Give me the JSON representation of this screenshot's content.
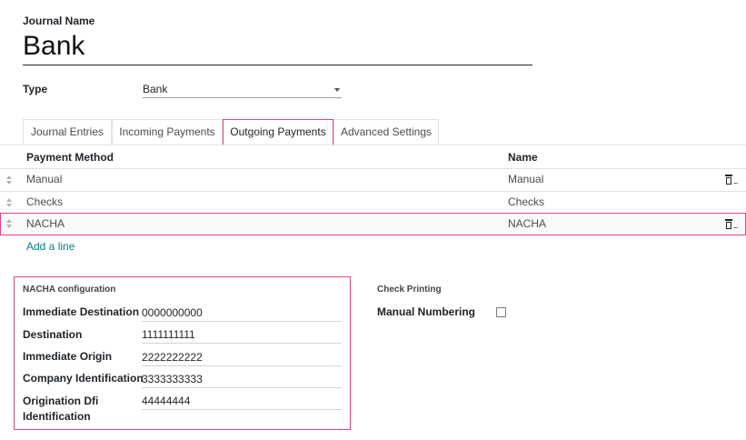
{
  "header": {
    "journal_name_label": "Journal Name",
    "journal_name_value": "Bank",
    "type_label": "Type",
    "type_value": "Bank"
  },
  "tabs": [
    {
      "label": "Journal Entries",
      "active": false
    },
    {
      "label": "Incoming Payments",
      "active": false
    },
    {
      "label": "Outgoing Payments",
      "active": true
    },
    {
      "label": "Advanced Settings",
      "active": false
    }
  ],
  "table": {
    "columns": [
      "Payment Method",
      "Name"
    ],
    "rows": [
      {
        "method": "Manual",
        "name": "Manual"
      },
      {
        "method": "Checks",
        "name": "Checks"
      },
      {
        "method": "NACHA",
        "name": "NACHA"
      }
    ],
    "trash_text": "...",
    "add_line": "Add a line"
  },
  "nacha": {
    "title": "NACHA configuration",
    "fields": [
      {
        "label": "Immediate Destination",
        "value": "0000000000"
      },
      {
        "label": "Destination",
        "value": "1111111111"
      },
      {
        "label": "Immediate Origin",
        "value": "2222222222"
      },
      {
        "label": "Company Identification",
        "value": "3333333333"
      },
      {
        "label": "Origination Dfi",
        "label2": "Identification",
        "value": "44444444"
      }
    ]
  },
  "check_printing": {
    "title": "Check Printing",
    "manual_numbering_label": "Manual Numbering",
    "manual_numbering_checked": false
  },
  "colors": {
    "highlight": "#e0457b",
    "link": "#017e84"
  },
  "icons": [
    "sort-handle-icon",
    "trash-icon",
    "caret-down-icon",
    "checkbox-icon"
  ]
}
